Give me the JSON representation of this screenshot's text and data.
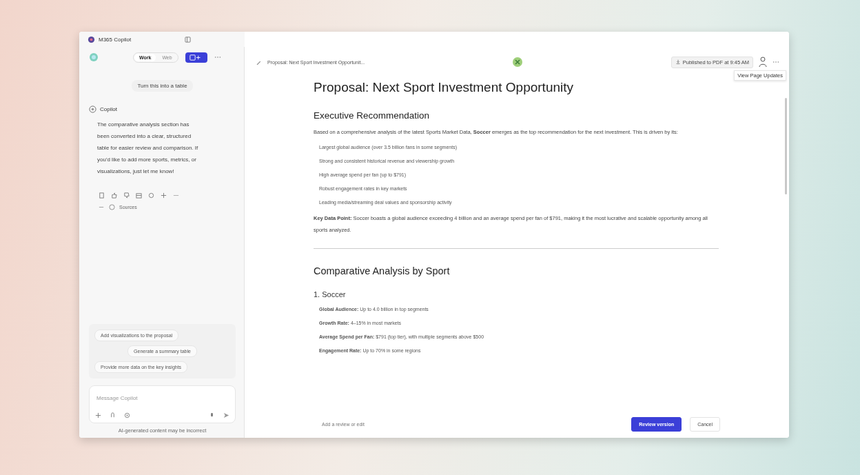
{
  "window": {
    "title": "M365 Copilot"
  },
  "sidebar": {
    "mode_tabs": [
      {
        "label": "Work",
        "selected": true
      },
      {
        "label": "Web",
        "selected": false
      }
    ],
    "user_message": "Turn this into a table",
    "assistant_name": "Copilot",
    "response": "The comparative analysis section has been converted into a clear, structured table for easier review and comparison. If you'd like to add more sports, metrics, or visualizations, just let me know!",
    "sources_label": "Sources",
    "suggestions": [
      "Add visualizations to the proposal",
      "Generate a summary table",
      "Provide more data on the key insights"
    ],
    "composer": {
      "placeholder": "Message Copilot"
    },
    "footer": "AI-generated content may be incorrect"
  },
  "document": {
    "breadcrumb": "Proposal: Next Sport Investment Opportunit...",
    "saved_status": "Published to PDF at 9:45 AM",
    "tooltip": "View Page Updates",
    "title": "Proposal: Next Sport Investment Opportunity",
    "executive": {
      "heading": "Executive Recommendation",
      "intro": "Based on a comprehensive analysis of the latest Sports Market Data, **Soccer** emerges as the top recommendation for the next investment. This is driven by its:",
      "bullets": [
        "Largest global audience (over 3.5 billion fans in some segments)",
        "Strong and consistent historical revenue and viewership growth",
        "High average spend per fan (up to $791)",
        "Robust engagement rates in key markets",
        "Leading media/streaming deal values and sponsorship activity"
      ],
      "key_point": "**Key Data Point:** Soccer boasts a global audience exceeding 4 billion and an average spend per fan of $791, making it the most lucrative and scalable opportunity among all sports analyzed."
    },
    "comparative": {
      "heading": "Comparative Analysis by Sport",
      "subsections": [
        {
          "heading": "1. Soccer",
          "bullets": [
            "**Global Audience:** Up to 4.0 billion in top segments",
            "**Growth Rate:** 4–15% in most markets",
            "**Average Spend per Fan:** $791 (top tier), with multiple segments above $500",
            "**Engagement Rate:** Up to 70% in some regions"
          ]
        }
      ]
    },
    "review_placeholder": "Add a review or edit",
    "buttons": [
      {
        "label": "Review version",
        "kind": "primary"
      },
      {
        "label": "Cancel",
        "kind": "secondary"
      }
    ]
  }
}
